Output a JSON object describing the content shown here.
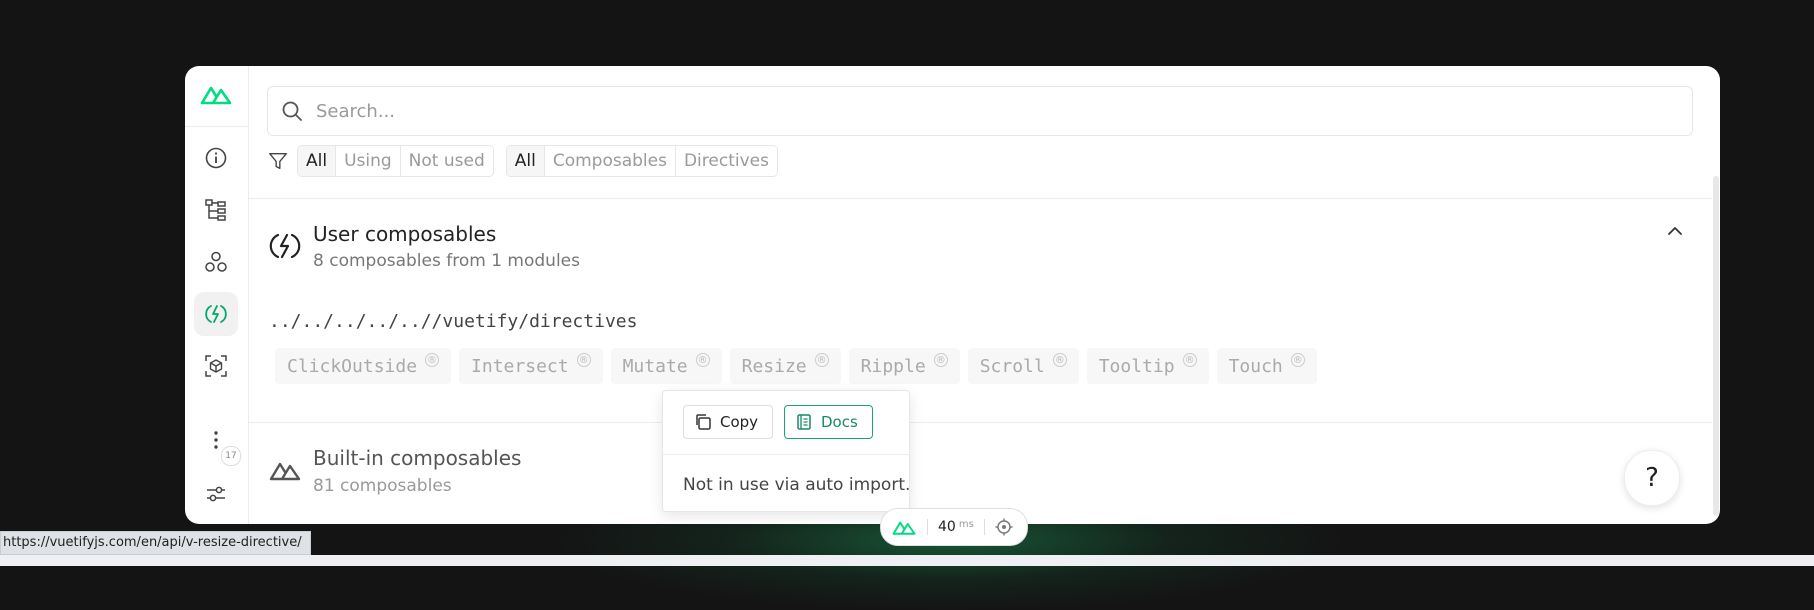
{
  "search": {
    "placeholder": "Search..."
  },
  "filters": {
    "usage": [
      "All",
      "Using",
      "Not used"
    ],
    "usage_selected": "All",
    "kind": [
      "All",
      "Composables",
      "Directives"
    ],
    "kind_selected": "All"
  },
  "sidebar": {
    "badge_count": "17"
  },
  "user_section": {
    "title": "User composables",
    "subtitle": "8 composables from 1 modules",
    "module_path": "../../../../..//vuetify/directives",
    "items": [
      "ClickOutside",
      "Intersect",
      "Mutate",
      "Resize",
      "Ripple",
      "Scroll",
      "Tooltip",
      "Touch"
    ]
  },
  "builtin_section": {
    "title": "Built-in composables",
    "subtitle": "81 composables"
  },
  "popup": {
    "copy_label": "Copy",
    "docs_label": "Docs",
    "note": "Not in use via auto import."
  },
  "perf": {
    "value": "40",
    "unit": "ms"
  },
  "status_url": "https://vuetifyjs.com/en/api/v-resize-directive/",
  "help_label": "?",
  "colors": {
    "accent": "#00DC82",
    "docs_border": "#1aa37a",
    "background": "#141414"
  }
}
